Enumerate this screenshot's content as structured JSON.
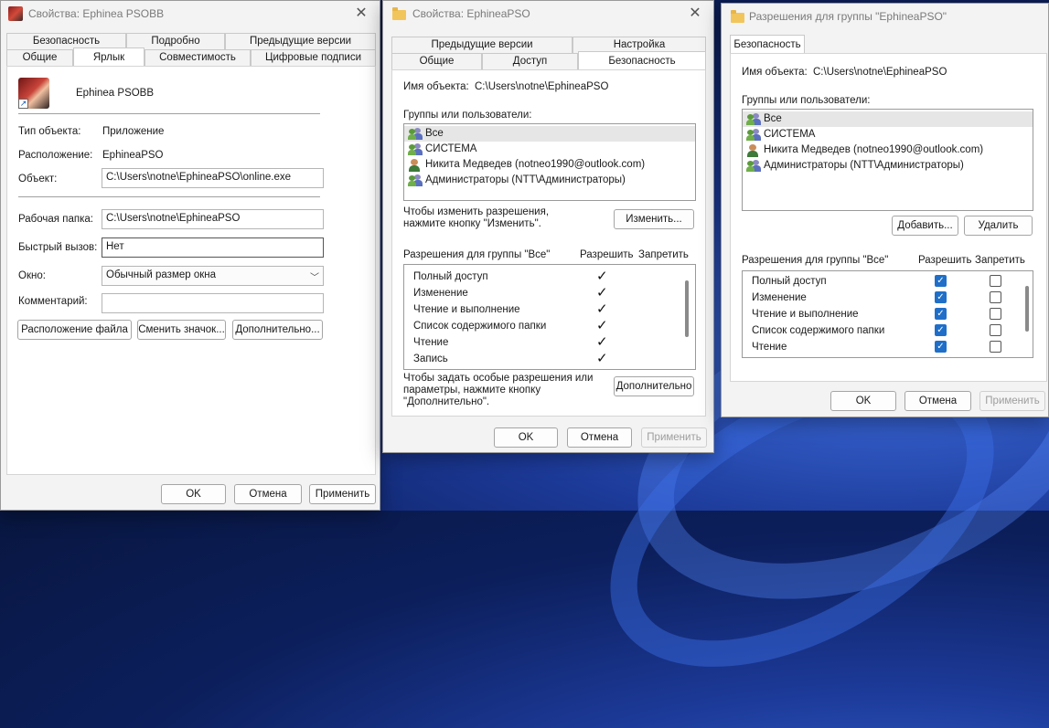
{
  "win1": {
    "title": "Свойства: Ephinea PSOBB",
    "tabs_row1": [
      "Безопасность",
      "Подробно",
      "Предыдущие версии"
    ],
    "tabs_row2": [
      "Общие",
      "Ярлык",
      "Совместимость",
      "Цифровые подписи"
    ],
    "active_tab": "Ярлык",
    "app_name": "Ephinea PSOBB",
    "labels": {
      "type": "Тип объекта:",
      "location": "Расположение:",
      "target": "Объект:",
      "workdir": "Рабочая папка:",
      "hotkey": "Быстрый вызов:",
      "window": "Окно:",
      "comment": "Комментарий:"
    },
    "values": {
      "type": "Приложение",
      "location": "EphineaPSO",
      "target": "C:\\Users\\notne\\EphineaPSO\\online.exe",
      "workdir": "C:\\Users\\notne\\EphineaPSO",
      "hotkey": "Нет",
      "window": "Обычный размер окна",
      "comment": ""
    },
    "buttons": {
      "file_location": "Расположение файла",
      "change_icon": "Сменить значок...",
      "advanced": "Дополнительно..."
    },
    "footer": {
      "ok": "OK",
      "cancel": "Отмена",
      "apply": "Применить"
    }
  },
  "win2": {
    "title": "Свойства: EphineaPSO",
    "tabs_row1": [
      "Предыдущие версии",
      "Настройка"
    ],
    "tabs_row2": [
      "Общие",
      "Доступ",
      "Безопасность"
    ],
    "active_tab": "Безопасность",
    "object_label": "Имя объекта:",
    "object_value": "C:\\Users\\notne\\EphineaPSO",
    "groups_label": "Группы или пользователи:",
    "users": [
      {
        "name": "Все",
        "icon": "group"
      },
      {
        "name": "СИСТЕМА",
        "icon": "group"
      },
      {
        "name": "Никита Медведев (notneo1990@outlook.com)",
        "icon": "user"
      },
      {
        "name": "Администраторы (NTT\\Администраторы)",
        "icon": "group"
      }
    ],
    "change_hint": "Чтобы изменить разрешения, нажмите кнопку \"Изменить\".",
    "change_button": "Изменить...",
    "perm_header": "Разрешения для группы \"Все\"",
    "allow_header": "Разрешить",
    "deny_header": "Запретить",
    "permissions": [
      {
        "name": "Полный доступ",
        "allow": true
      },
      {
        "name": "Изменение",
        "allow": true
      },
      {
        "name": "Чтение и выполнение",
        "allow": true
      },
      {
        "name": "Список содержимого папки",
        "allow": true
      },
      {
        "name": "Чтение",
        "allow": true
      },
      {
        "name": "Запись",
        "allow": true
      }
    ],
    "special_hint": "Чтобы задать особые разрешения или параметры, нажмите кнопку \"Дополнительно\".",
    "advanced_button": "Дополнительно",
    "footer": {
      "ok": "OK",
      "cancel": "Отмена",
      "apply": "Применить"
    }
  },
  "win3": {
    "title": "Разрешения для группы \"EphineaPSO\"",
    "tab": "Безопасность",
    "object_label": "Имя объекта:",
    "object_value": "C:\\Users\\notne\\EphineaPSO",
    "groups_label": "Группы или пользователи:",
    "users": [
      {
        "name": "Все",
        "icon": "group"
      },
      {
        "name": "СИСТЕМА",
        "icon": "group"
      },
      {
        "name": "Никита Медведев (notneo1990@outlook.com)",
        "icon": "user"
      },
      {
        "name": "Администраторы (NTT\\Администраторы)",
        "icon": "group"
      }
    ],
    "add_button": "Добавить...",
    "remove_button": "Удалить",
    "perm_header": "Разрешения для группы \"Все\"",
    "allow_header": "Разрешить",
    "deny_header": "Запретить",
    "permissions": [
      {
        "name": "Полный доступ",
        "allow": true,
        "deny": false
      },
      {
        "name": "Изменение",
        "allow": true,
        "deny": false
      },
      {
        "name": "Чтение и выполнение",
        "allow": true,
        "deny": false
      },
      {
        "name": "Список содержимого папки",
        "allow": true,
        "deny": false
      },
      {
        "name": "Чтение",
        "allow": true,
        "deny": false
      }
    ],
    "footer": {
      "ok": "OK",
      "cancel": "Отмена",
      "apply": "Применить"
    }
  }
}
